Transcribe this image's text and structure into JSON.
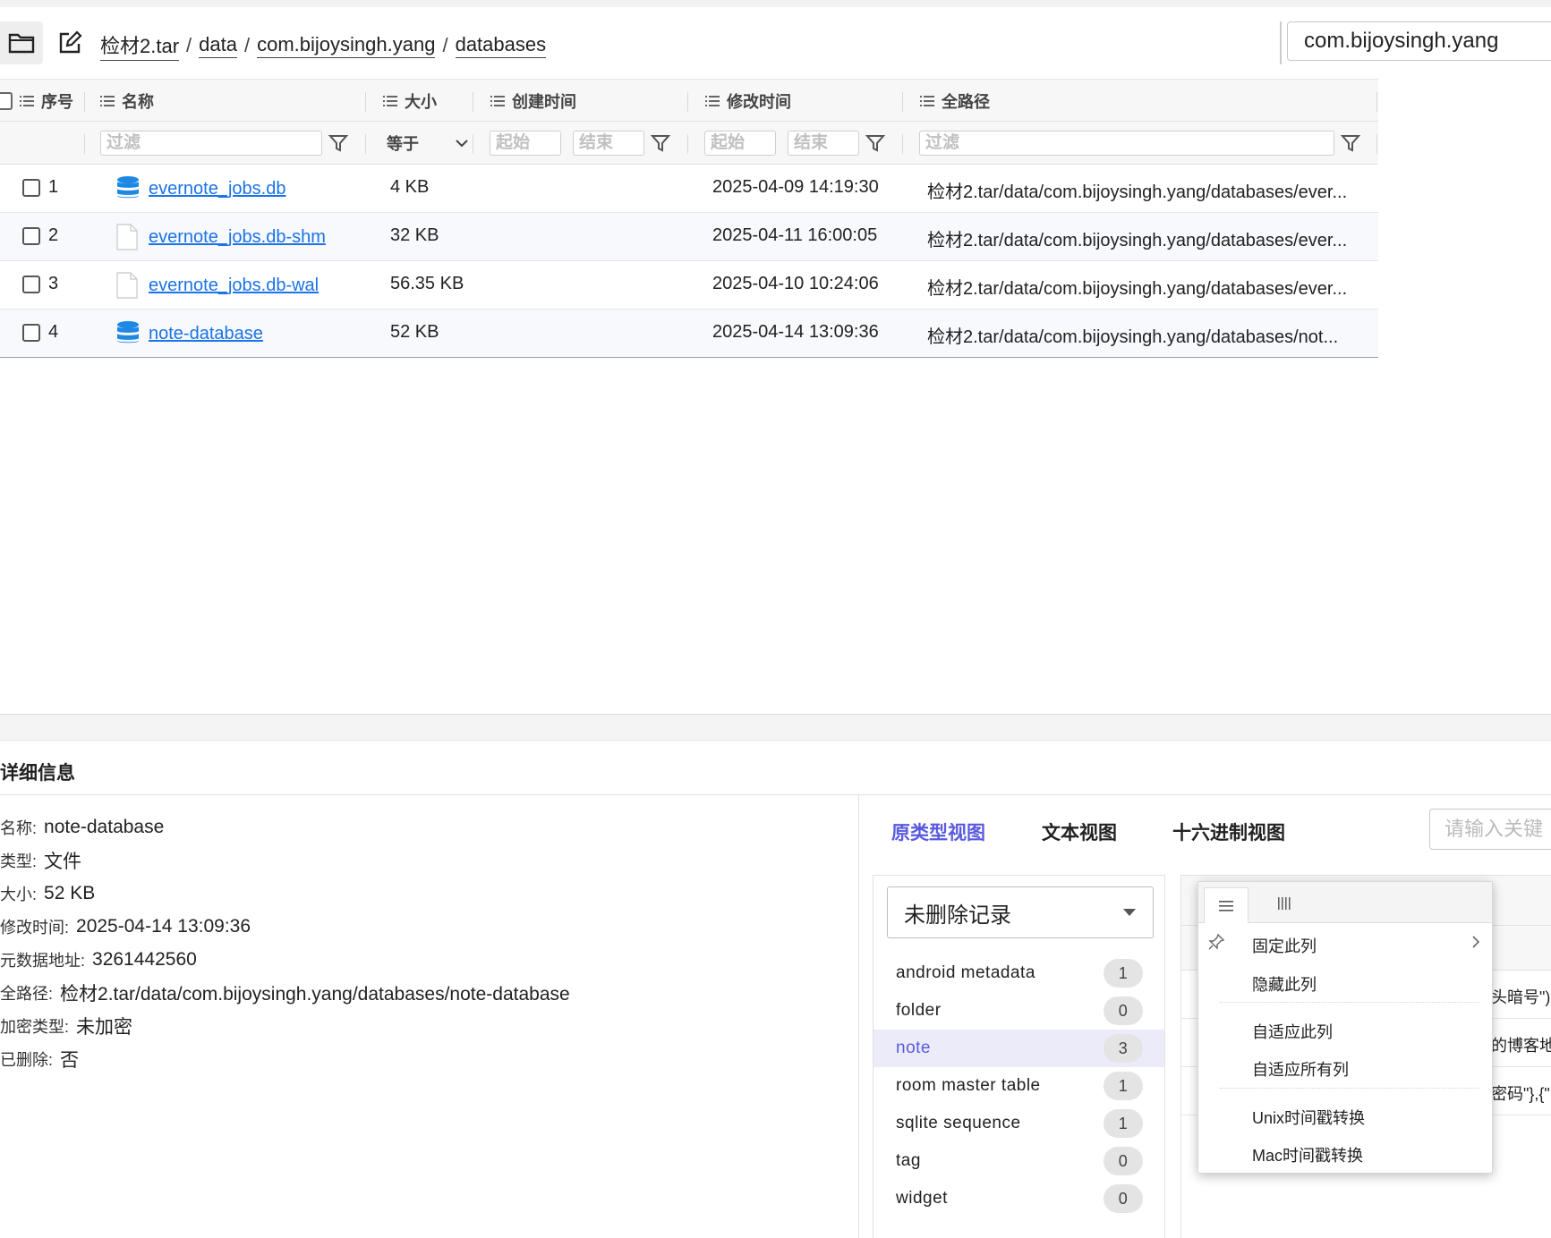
{
  "breadcrumb": [
    "检材2.tar",
    "data",
    "com.bijoysingh.yang",
    "databases"
  ],
  "path_input": "com.bijoysingh.yang",
  "columns": {
    "index": "序号",
    "name": "名称",
    "size": "大小",
    "ctime": "创建时间",
    "mtime": "修改时间",
    "path": "全路径"
  },
  "filters": {
    "name_placeholder": "过滤",
    "size_op": "等于",
    "start": "起始",
    "end": "结束",
    "path_placeholder": "过滤"
  },
  "rows": [
    {
      "index": "1",
      "icon": "database-icon",
      "name": "evernote_jobs.db",
      "size": "4 KB",
      "mtime": "2025-04-09 14:19:30",
      "path": "检材2.tar/data/com.bijoysingh.yang/databases/ever..."
    },
    {
      "index": "2",
      "icon": "file-icon",
      "name": "evernote_jobs.db-shm",
      "size": "32 KB",
      "mtime": "2025-04-11 16:00:05",
      "path": "检材2.tar/data/com.bijoysingh.yang/databases/ever..."
    },
    {
      "index": "3",
      "icon": "file-icon",
      "name": "evernote_jobs.db-wal",
      "size": "56.35 KB",
      "mtime": "2025-04-10 10:24:06",
      "path": "检材2.tar/data/com.bijoysingh.yang/databases/ever..."
    },
    {
      "index": "4",
      "icon": "database-icon",
      "name": "note-database",
      "size": "52 KB",
      "mtime": "2025-04-14 13:09:36",
      "path": "检材2.tar/data/com.bijoysingh.yang/databases/not..."
    }
  ],
  "detail": {
    "title": "详细信息",
    "fields": [
      {
        "key": "名称:",
        "value": "note-database"
      },
      {
        "key": "类型:",
        "value": "文件"
      },
      {
        "key": "大小:",
        "value": "52 KB"
      },
      {
        "key": "修改时间:",
        "value": "2025-04-14 13:09:36"
      },
      {
        "key": "元数据地址:",
        "value": "3261442560"
      },
      {
        "key": "全路径:",
        "value": "检材2.tar/data/com.bijoysingh.yang/databases/note-database"
      },
      {
        "key": "加密类型:",
        "value": "未加密"
      },
      {
        "key": "已删除:",
        "value": "否"
      }
    ]
  },
  "view_tabs": {
    "raw": "原类型视图",
    "text": "文本视图",
    "hex": "十六进制视图",
    "keyword_placeholder": "请输入关键"
  },
  "record_select": "未删除记录",
  "tables": [
    {
      "name": "android metadata",
      "count": "1"
    },
    {
      "name": "folder",
      "count": "0"
    },
    {
      "name": "note",
      "count": "3",
      "active": true
    },
    {
      "name": "room master table",
      "count": "1"
    },
    {
      "name": "sqlite sequence",
      "count": "1"
    },
    {
      "name": "tag",
      "count": "0"
    },
    {
      "name": "widget",
      "count": "0"
    }
  ],
  "data_cells": [
    "头暗号\")",
    "的博客地",
    "密码\"},{\""
  ],
  "context_menu": {
    "pin": "固定此列",
    "hide": "隐藏此列",
    "autofit": "自适应此列",
    "autofit_all": "自适应所有列",
    "unix_ts": "Unix时间戳转换",
    "mac_ts": "Mac时间戳转换"
  },
  "colors": {
    "link": "#1a73e8",
    "accent": "#5a5ae0",
    "db_icon": "#1e88e5"
  }
}
